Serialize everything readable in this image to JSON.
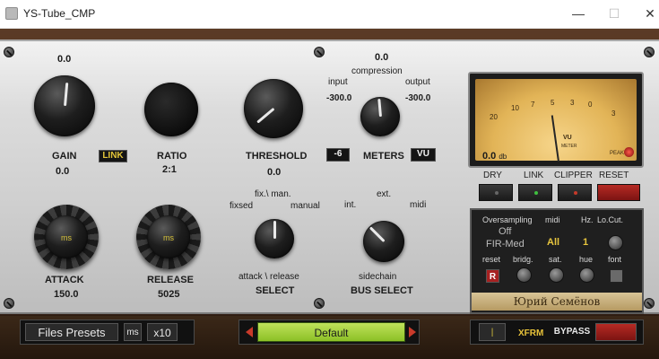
{
  "window": {
    "title": "YS-Tube_CMP",
    "minimize": "—",
    "maximize": "☐",
    "close": "✕"
  },
  "gain": {
    "top_value": "0.0",
    "label": "GAIN",
    "value": "0.0",
    "link": "LINK"
  },
  "ratio": {
    "label": "RATIO",
    "value": "2:1"
  },
  "threshold": {
    "label": "THRESHOLD",
    "value": "0.0"
  },
  "meters": {
    "compression_value": "0.0",
    "compression_label": "compression",
    "input_label": "input",
    "input_value": "-300.0",
    "output_label": "output",
    "output_value": "-300.0",
    "minus6": "-6",
    "label": "METERS",
    "vu": "VU"
  },
  "attack": {
    "label": "ATTACK",
    "value": "150.0",
    "unit": "ms"
  },
  "release": {
    "label": "RELEASE",
    "value": "5025",
    "unit": "ms"
  },
  "select": {
    "fixsed": "fixsed",
    "fixman": "fix.\\ man.",
    "manual": "manual",
    "attack_release": "attack \\ release",
    "label": "SELECT"
  },
  "bus_select": {
    "ext": "ext.",
    "int": "int.",
    "midi": "midi",
    "sidechain": "sidechain",
    "label": "BUS SELECT"
  },
  "vu_meter": {
    "scale": [
      "20",
      "10",
      "7",
      "5",
      "3",
      "0",
      "3"
    ],
    "db_readout": "0.0",
    "db_unit": "db",
    "logo": "VU",
    "logo_sub": "METER",
    "peak": "PEAK"
  },
  "switches": {
    "dry": "DRY",
    "link": "LINK",
    "clipper": "CLIPPER",
    "reset": "RESET"
  },
  "options": {
    "oversampling": "Oversampling",
    "midi": "midi",
    "hz": "Hz.",
    "locut": "Lo.Cut.",
    "oversampling_value": "Off",
    "fir": "FIR-Med",
    "midi_value": "All",
    "hz_value": "1",
    "reset": "reset",
    "bridg": "bridg.",
    "sat": "sat.",
    "hue": "hue",
    "font": "font",
    "r": "R",
    "signature": "Юрий Семёнов"
  },
  "bottom": {
    "files_presets": "Files  Presets",
    "ms": "ms",
    "x10": "x10",
    "preset_name": "Default",
    "xfrm": "XFRM",
    "bypass": "BYPASS"
  }
}
